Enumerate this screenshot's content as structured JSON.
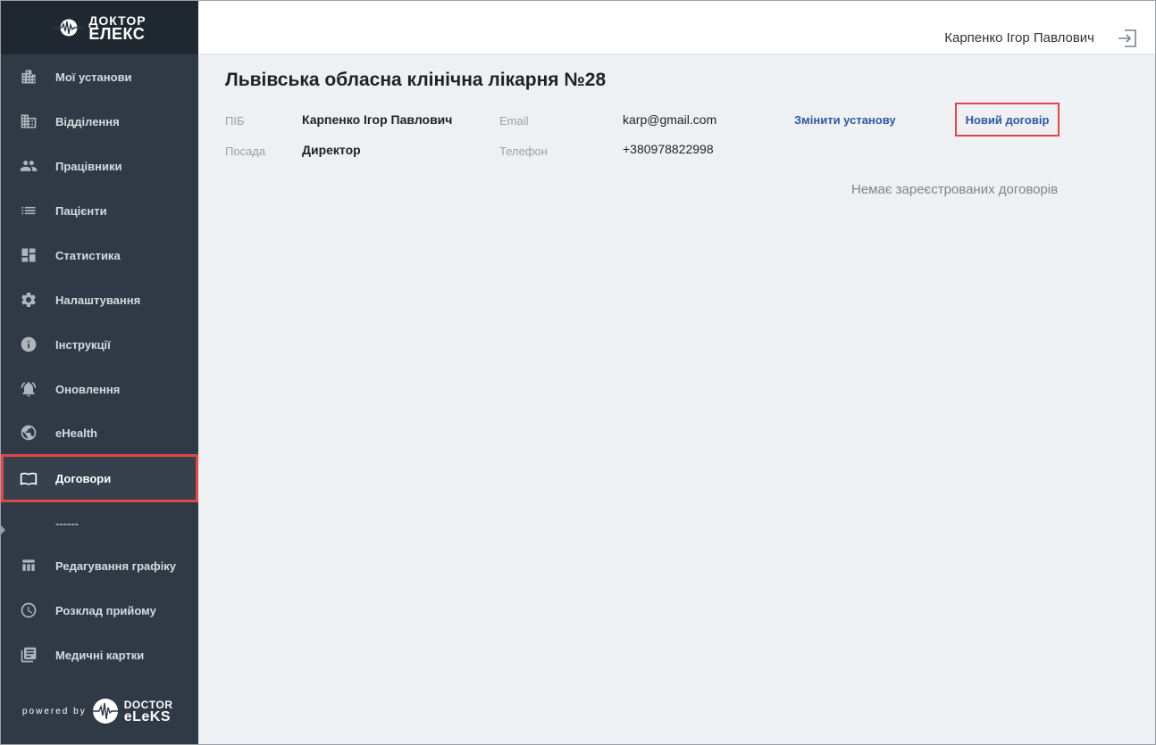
{
  "brand": {
    "line1": "ДОКТОР",
    "line2": "ЕЛЕКС"
  },
  "sidebar": {
    "items": [
      {
        "label": "Мої установи",
        "icon": "building-icon"
      },
      {
        "label": "Відділення",
        "icon": "office-icon"
      },
      {
        "label": "Працівники",
        "icon": "people-icon"
      },
      {
        "label": "Пацієнти",
        "icon": "list-icon"
      },
      {
        "label": "Статистика",
        "icon": "dashboard-icon"
      },
      {
        "label": "Налаштування",
        "icon": "gear-icon"
      },
      {
        "label": "Інструкції",
        "icon": "info-icon"
      },
      {
        "label": "Оновлення",
        "icon": "bell-icon"
      },
      {
        "label": "eHealth",
        "icon": "globe-icon"
      },
      {
        "label": "Договори",
        "icon": "book-icon",
        "active": true
      }
    ],
    "separator": "------",
    "items2": [
      {
        "label": "Редагування графіку",
        "icon": "table-icon"
      },
      {
        "label": "Розклад прийому",
        "icon": "clock-icon"
      },
      {
        "label": "Медичні картки",
        "icon": "cards-icon"
      }
    ],
    "powered_by": "powered by",
    "powered_brand1": "DOCTOR",
    "powered_brand2": "eLeKS"
  },
  "header": {
    "user_name": "Карпенко Ігор Павлович"
  },
  "main": {
    "title": "Львівська обласна клінічна лікарня №28",
    "pib_label": "ПІБ",
    "pib_value": "Карпенко Ігор Павлович",
    "position_label": "Посада",
    "position_value": "Директор",
    "email_label": "Email",
    "email_value": "karp@gmail.com",
    "phone_label": "Телефон",
    "phone_value": "+380978822998",
    "change_link": "Змінити установу",
    "new_contract": "Новий договір",
    "empty_message": "Немає зареєстрованих договорів"
  },
  "colors": {
    "sidebar": "#2f3a46",
    "brand_bar": "#1f2831",
    "link": "#2d5aa0",
    "highlight": "#e04848"
  }
}
